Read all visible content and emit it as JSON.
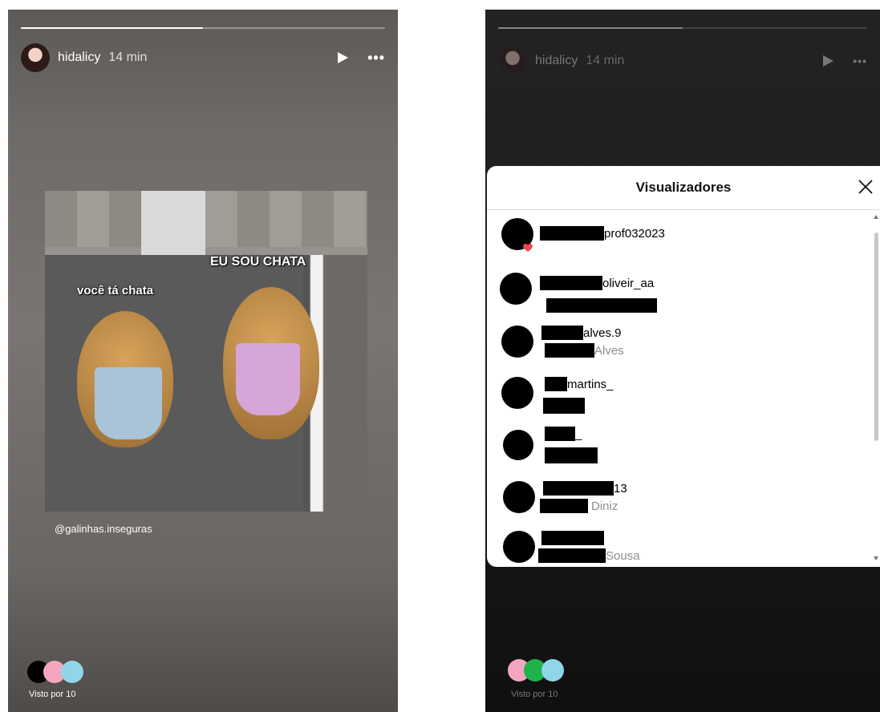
{
  "left_story": {
    "username": "hidalicy",
    "time": "14 min",
    "post": {
      "caption_left": "você tá chata",
      "caption_right": "EU SOU CHATA",
      "credit": "@galinhas.inseguras"
    },
    "seen_by": "Visto por 10",
    "viewer_colors": [
      "#000000",
      "#f4a6c0",
      "#8fd6e8"
    ]
  },
  "right_story": {
    "username": "hidalicy",
    "time": "14 min",
    "seen_by": "Visto por 10",
    "viewer_colors": [
      "#f4a6c0",
      "#1fb34a",
      "#8fd6e8"
    ]
  },
  "viewers_modal": {
    "title": "Visualizadores",
    "viewers": [
      {
        "handle_suffix": "prof032023",
        "name_suffix": ""
      },
      {
        "handle_suffix": "oliveir_aa",
        "name_suffix": ""
      },
      {
        "handle_suffix": "alves.9",
        "name_suffix": "Alves"
      },
      {
        "handle_suffix": "martins_",
        "name_suffix": ""
      },
      {
        "handle_suffix": "_",
        "name_suffix": ""
      },
      {
        "handle_suffix": "13",
        "name_suffix": "Diniz"
      },
      {
        "handle_suffix": "",
        "name_suffix": "Sousa"
      }
    ]
  }
}
